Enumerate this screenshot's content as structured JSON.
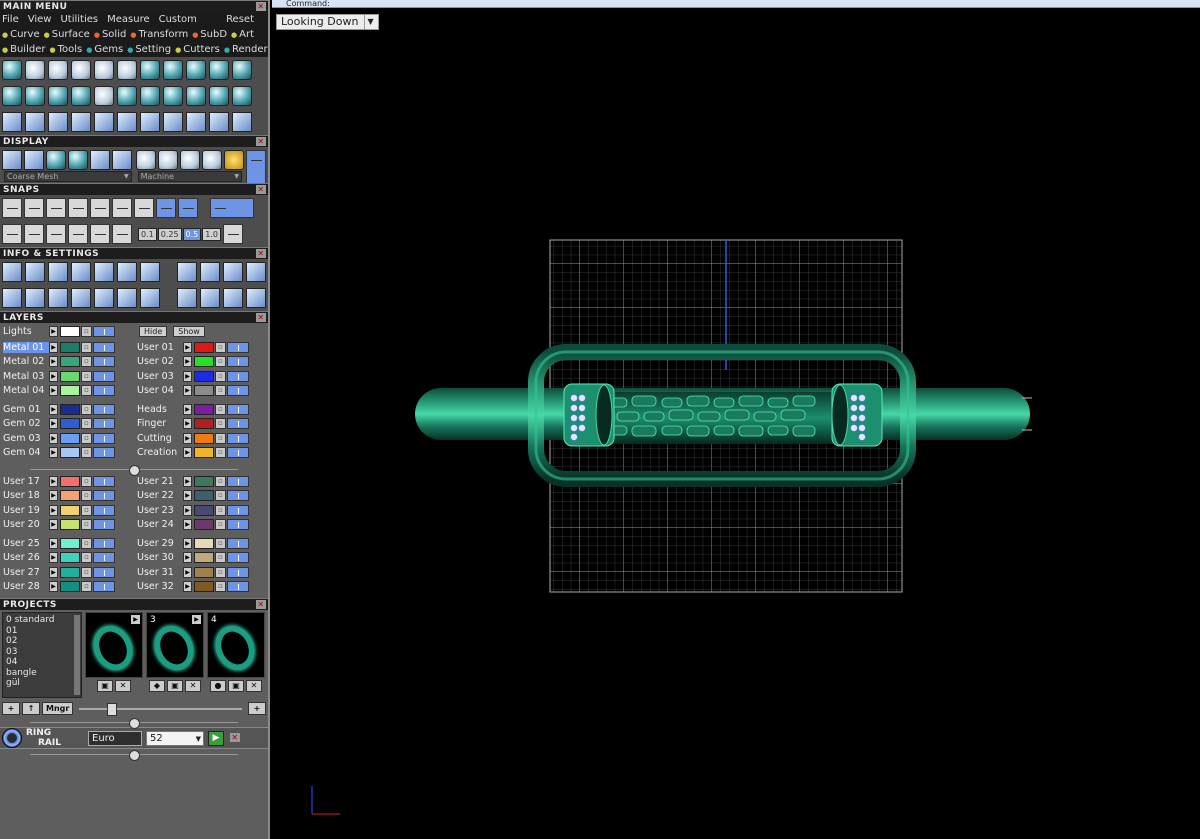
{
  "main_menu": {
    "title": "MAIN MENU",
    "menus": [
      "File",
      "View",
      "Utilities",
      "Measure",
      "Custom"
    ],
    "reset": "Reset",
    "row1": [
      {
        "t": "Curve",
        "c": "y"
      },
      {
        "t": "Surface",
        "c": "y"
      },
      {
        "t": "Solid",
        "c": "r"
      },
      {
        "t": "Transform",
        "c": "r"
      },
      {
        "t": "SubD",
        "c": "r"
      },
      {
        "t": "Art",
        "c": "y"
      }
    ],
    "row2": [
      {
        "t": "Builder",
        "c": "y"
      },
      {
        "t": "Tools",
        "c": "y"
      },
      {
        "t": "Gems",
        "c": "b"
      },
      {
        "t": "Setting",
        "c": "b"
      },
      {
        "t": "Cutters",
        "c": "y"
      },
      {
        "t": "Render",
        "c": "b"
      }
    ]
  },
  "display": {
    "title": "DISPLAY",
    "mesh_select": "Coarse Mesh",
    "material_select": "Machine"
  },
  "snaps": {
    "title": "SNAPS",
    "values": [
      "0.1",
      "0.25",
      "0.5",
      "1.0"
    ]
  },
  "info": {
    "title": "INFO & SETTINGS"
  },
  "layers": {
    "title": "LAYERS",
    "lights": "Lights",
    "hide": "Hide",
    "show": "Show",
    "groups": [
      {
        "left": [
          [
            "Metal 01",
            "#1d7e68"
          ],
          [
            "Metal 02",
            "#3aa57c"
          ],
          [
            "Metal 03",
            "#6ad870"
          ],
          [
            "Metal 04",
            "#a9f2a0"
          ]
        ],
        "right": [
          [
            "User 01",
            "#e01818"
          ],
          [
            "User 02",
            "#25e025"
          ],
          [
            "User 03",
            "#1b2ce8"
          ],
          [
            "User 04",
            "#8c8c8c"
          ]
        ]
      },
      {
        "left": [
          [
            "Gem 01",
            "#1a2c8e"
          ],
          [
            "Gem 02",
            "#2e5fd0"
          ],
          [
            "Gem 03",
            "#6b9df0"
          ],
          [
            "Gem 04",
            "#a6c6f6"
          ]
        ],
        "right": [
          [
            "Heads",
            "#7a1e9e"
          ],
          [
            "Finger",
            "#b02020"
          ],
          [
            "Cutting",
            "#f07c10"
          ],
          [
            "Creation",
            "#f0b428"
          ]
        ]
      },
      {
        "left": [
          [
            "User 17",
            "#f07070"
          ],
          [
            "User 18",
            "#f4a070"
          ],
          [
            "User 19",
            "#f0d070"
          ],
          [
            "User 20",
            "#c8e070"
          ]
        ],
        "right": [
          [
            "User 21",
            "#3d7a5c"
          ],
          [
            "User 22",
            "#3d6070"
          ],
          [
            "User 23",
            "#4a4a70"
          ],
          [
            "User 24",
            "#6a3a6a"
          ]
        ]
      },
      {
        "left": [
          [
            "User 25",
            "#70f0d0"
          ],
          [
            "User 26",
            "#40d0c0"
          ],
          [
            "User 27",
            "#20b0a0"
          ],
          [
            "User 28",
            "#109080"
          ]
        ],
        "right": [
          [
            "User 29",
            "#e8d8b8"
          ],
          [
            "User 30",
            "#c0a880"
          ],
          [
            "User 31",
            "#a08050"
          ],
          [
            "User 32",
            "#805a20"
          ]
        ]
      }
    ],
    "selected": "Metal 01"
  },
  "projects": {
    "title": "PROJECTS",
    "list": [
      "0 standard",
      "01",
      "02",
      "03",
      "04",
      "bangle",
      "gül"
    ],
    "thumbs": [
      "",
      "3",
      "4"
    ],
    "mngr": "Mngr"
  },
  "ring_rail": {
    "label1": "RING",
    "label2": "RAIL",
    "size_system": "Euro",
    "size": "52"
  },
  "viewport": {
    "command": "Command:",
    "view_name": "Looking Down"
  }
}
